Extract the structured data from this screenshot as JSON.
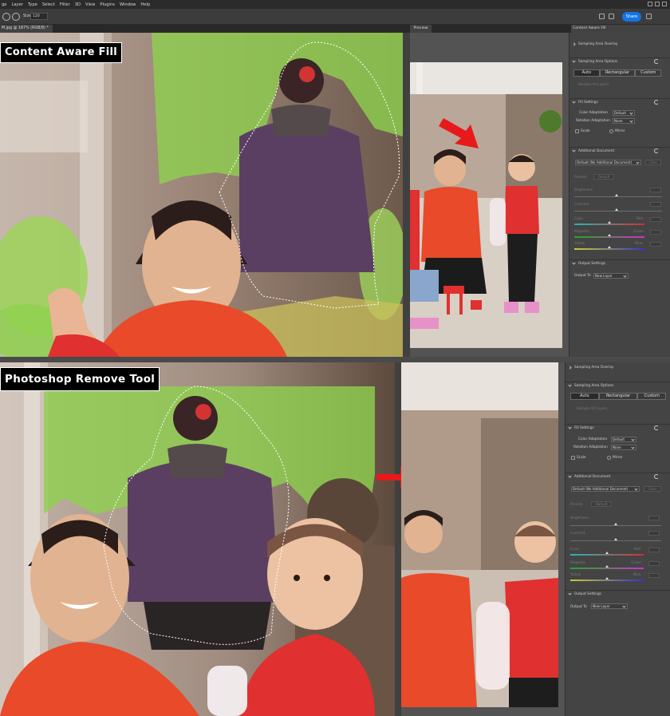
{
  "menu": [
    "ge",
    "Layer",
    "Type",
    "Select",
    "Filter",
    "3D",
    "View",
    "Plugins",
    "Window",
    "Help"
  ],
  "options": {
    "size_label": "Size:",
    "size_value": "120",
    "share_label": "Share"
  },
  "tabs": {
    "document": "M.jpg @ 167% (RGB/8) *",
    "preview": "Preview",
    "panel": "Content Aware Fill"
  },
  "labels": {
    "top": "Content Aware Fill",
    "bottom": "Photoshop Remove Tool"
  },
  "caf": {
    "sampling_overlay": "Sampling Area Overlay",
    "sampling_options": "Sampling Area Options",
    "modes": [
      "Auto",
      "Rectangular",
      "Custom"
    ],
    "sample_all_layers": "Sample All Layers",
    "fill_settings": "Fill Settings",
    "color_adaptation_label": "Color Adaptation",
    "color_adaptation_value": "Default",
    "rotation_adaptation_label": "Rotation Adaptation",
    "rotation_adaptation_value": "None",
    "scale_label": "Scale",
    "mirror_label": "Mirror",
    "additional_document": "Additional Document",
    "additional_document_value": "Default (No Additional Document)",
    "clear_label": "Clear",
    "preset_label": "Presets",
    "default_button": "Default",
    "brightness_label": "Brightness",
    "contrast_label": "Contrast",
    "cyan_label": "Cyan",
    "red_label": "Red",
    "magenta_label": "Magenta",
    "green_label": "Green",
    "yellow_label": "Yellow",
    "blue_label": "Blue",
    "output_settings": "Output Settings",
    "output_to_label": "Output To",
    "output_to_value": "New Layer"
  },
  "colors": {
    "accent": "#1473e6",
    "arrow": "#e8191a",
    "overlay_green": "#8fd14f",
    "shirt_orange": "#e84a2a"
  }
}
